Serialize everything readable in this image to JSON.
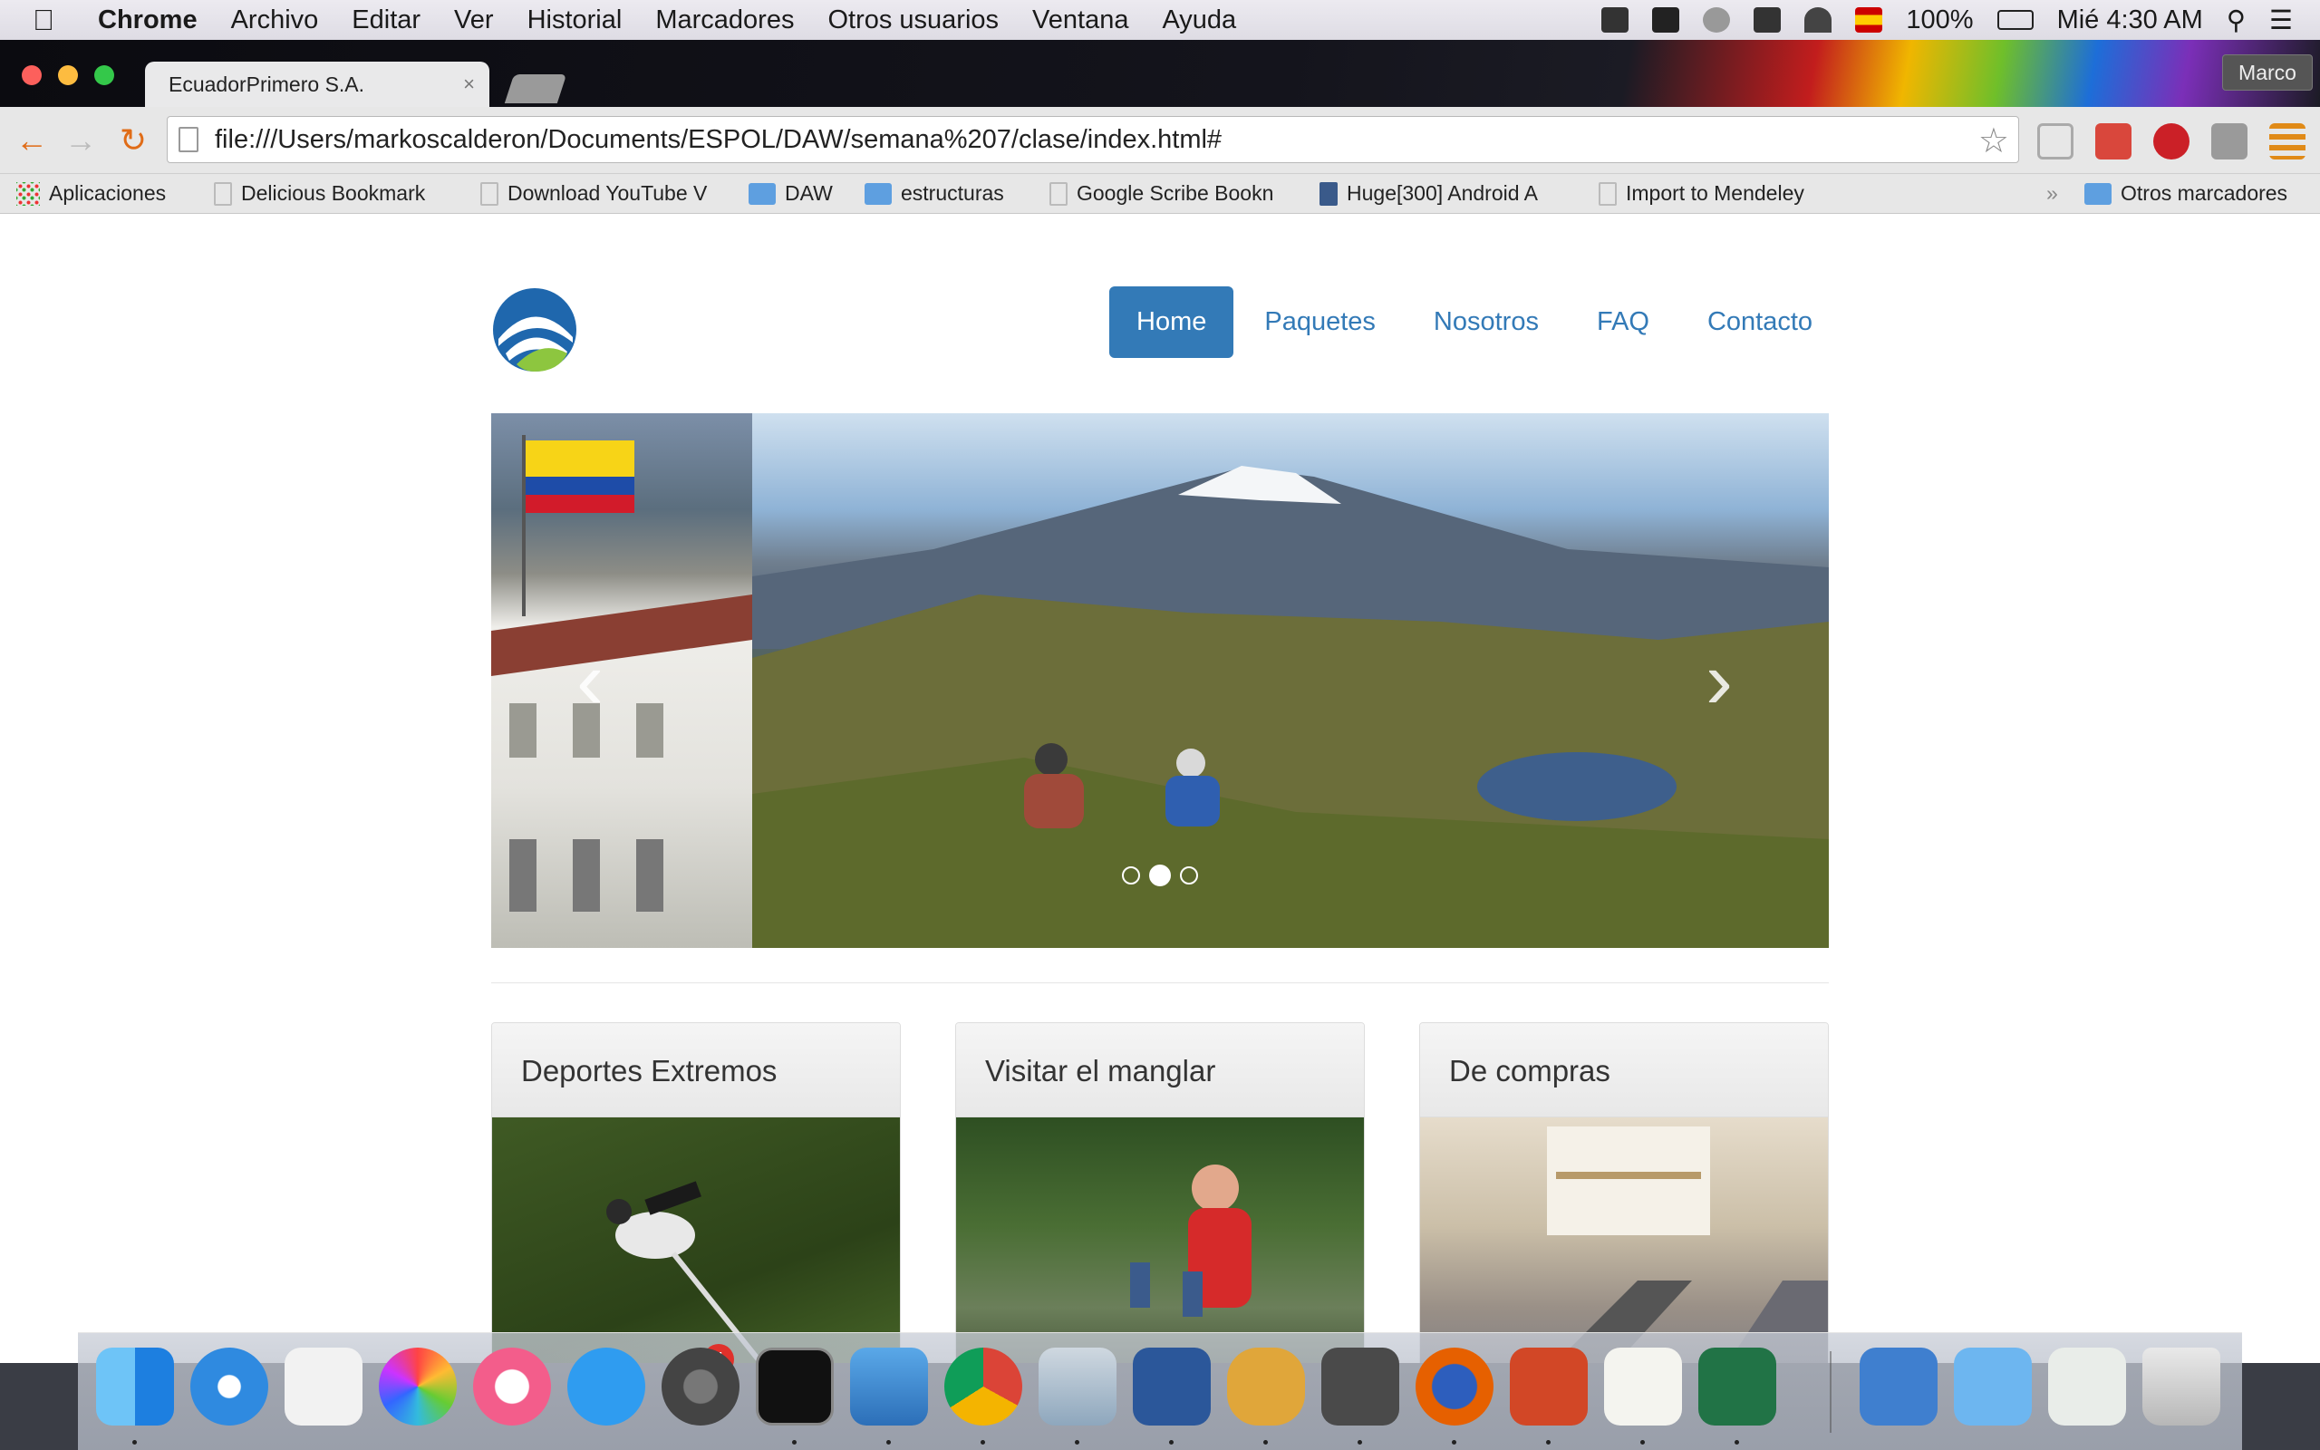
{
  "menubar": {
    "app": "Chrome",
    "items": [
      "Archivo",
      "Editar",
      "Ver",
      "Historial",
      "Marcadores",
      "Otros usuarios",
      "Ventana",
      "Ayuda"
    ],
    "battery": "100%",
    "clock": "Mié 4:30 AM"
  },
  "browser": {
    "tab_title": "EcuadorPrimero S.A.",
    "profile": "Marco",
    "url": "file:///Users/markoscalderon/Documents/ESPOL/DAW/semana%207/clase/index.html#"
  },
  "bookmarks": [
    {
      "label": "Aplicaciones",
      "icon": "apps-grid-icon"
    },
    {
      "label": "Delicious Bookmark",
      "icon": "page-icon"
    },
    {
      "label": "Download YouTube V",
      "icon": "page-icon"
    },
    {
      "label": "DAW",
      "icon": "folder-icon"
    },
    {
      "label": "estructuras",
      "icon": "folder-icon"
    },
    {
      "label": "Google Scribe Bookn",
      "icon": "page-icon"
    },
    {
      "label": "Huge[300] Android A",
      "icon": "android-icon"
    },
    {
      "label": "Import to Mendeley",
      "icon": "page-icon"
    },
    {
      "label": "Otros marcadores",
      "icon": "folder-icon"
    }
  ],
  "site": {
    "nav": [
      "Home",
      "Paquetes",
      "Nosotros",
      "FAQ",
      "Contacto"
    ],
    "active_nav": "Home",
    "carousel": {
      "slides": 3,
      "active_index": 1
    },
    "cards": [
      {
        "title": "Deportes Extremos"
      },
      {
        "title": "Visitar el manglar"
      },
      {
        "title": "De compras"
      }
    ]
  },
  "dock": {
    "apps": [
      "Finder",
      "Safari",
      "Launchpad",
      "Photos",
      "iTunes",
      "App Store",
      "System Preferences",
      "Terminal",
      "Keynote",
      "Chrome",
      "Preview",
      "Word",
      "Mockup",
      "Sublime Text",
      "Firefox",
      "PowerPoint",
      "TextEdit",
      "Excel",
      "7zX",
      "Documents",
      "Numbers",
      "Trash"
    ],
    "app_store_badge": "4"
  },
  "colors": {
    "brand": "#337ab7",
    "accent_orange": "#e06c17"
  }
}
